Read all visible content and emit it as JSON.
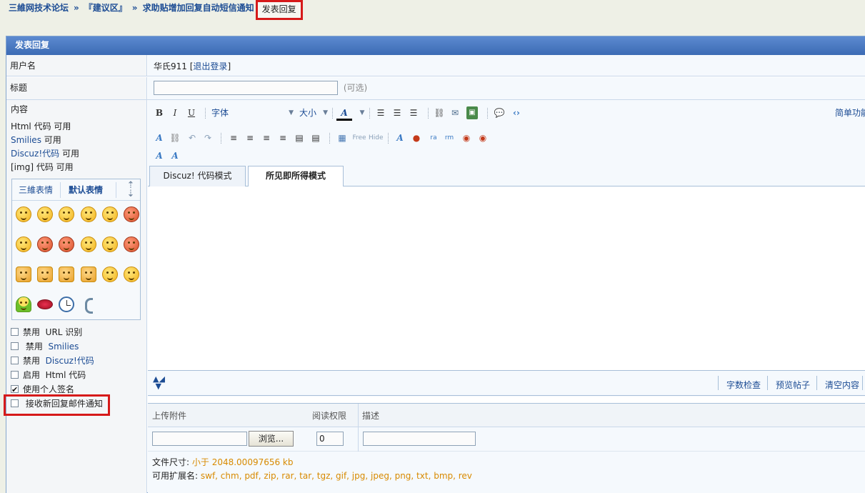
{
  "breadcrumb": {
    "forum": "三維网技术论坛",
    "sep": "»",
    "section": "『建议区』",
    "thread": "求助贴增加回复自动短信通知",
    "current": "发表回复"
  },
  "panel": {
    "title": "发表回复"
  },
  "username_row": {
    "label": "用户名",
    "value": "华氏911",
    "open_bracket": "[",
    "logout": "退出登录",
    "close_bracket": "]"
  },
  "title_row": {
    "label": "标题",
    "hint": "(可选)"
  },
  "content_info": {
    "label": "内容",
    "html_line_a": "Html 代码",
    "html_line_b": "可用",
    "smilies_a": "Smilies",
    "smilies_b": "可用",
    "discuz_a": "Discuz!代码",
    "discuz_b": "可用",
    "img_a": "[img] 代码",
    "img_b": "可用"
  },
  "smilies_box": {
    "tab1": "三維表情",
    "tab2": "默认表情"
  },
  "options": [
    {
      "label_a": "禁用",
      "label_b": "URL 识别",
      "checked": false
    },
    {
      "label_a": "禁用",
      "label_b": "Smilies",
      "checked": false
    },
    {
      "label_a": "禁用",
      "label_b": "Discuz!代码",
      "checked": false
    },
    {
      "label_a": "启用",
      "label_b": "Html 代码",
      "checked": false
    },
    {
      "label_a": "使用个人签名",
      "label_b": "",
      "checked": true
    },
    {
      "label_a": "接收新回复邮件通知",
      "label_b": "",
      "checked": false
    }
  ],
  "toolbar": {
    "bold": "B",
    "italic": "I",
    "underline": "U",
    "font": "字体",
    "size": "大小",
    "color": "A",
    "simple_mode": "简单功能"
  },
  "editor_tabs": {
    "code_mode": "Discuz! 代码模式",
    "wysiwyg_mode": "所见即所得模式"
  },
  "editor_bottom": {
    "word_check": "字数检查",
    "preview": "预览帖子",
    "clear": "清空内容"
  },
  "attachments": {
    "col_upload": "上传附件",
    "col_perm": "阅读权限",
    "col_desc": "描述",
    "browse": "浏览...",
    "perm_value": "0",
    "size_label": "文件尺寸:",
    "size_value": "小于  2048.00097656 kb",
    "ext_label": "可用扩展名:",
    "ext_value": "swf, chm, pdf, zip, rar, tar, tgz, gif, jpg, jpeg, png, txt, bmp, rev"
  },
  "colors": {
    "link": "#1c4c94",
    "header": "#4a7ac4",
    "highlight": "#d61a1a",
    "orange": "#d88a00"
  }
}
